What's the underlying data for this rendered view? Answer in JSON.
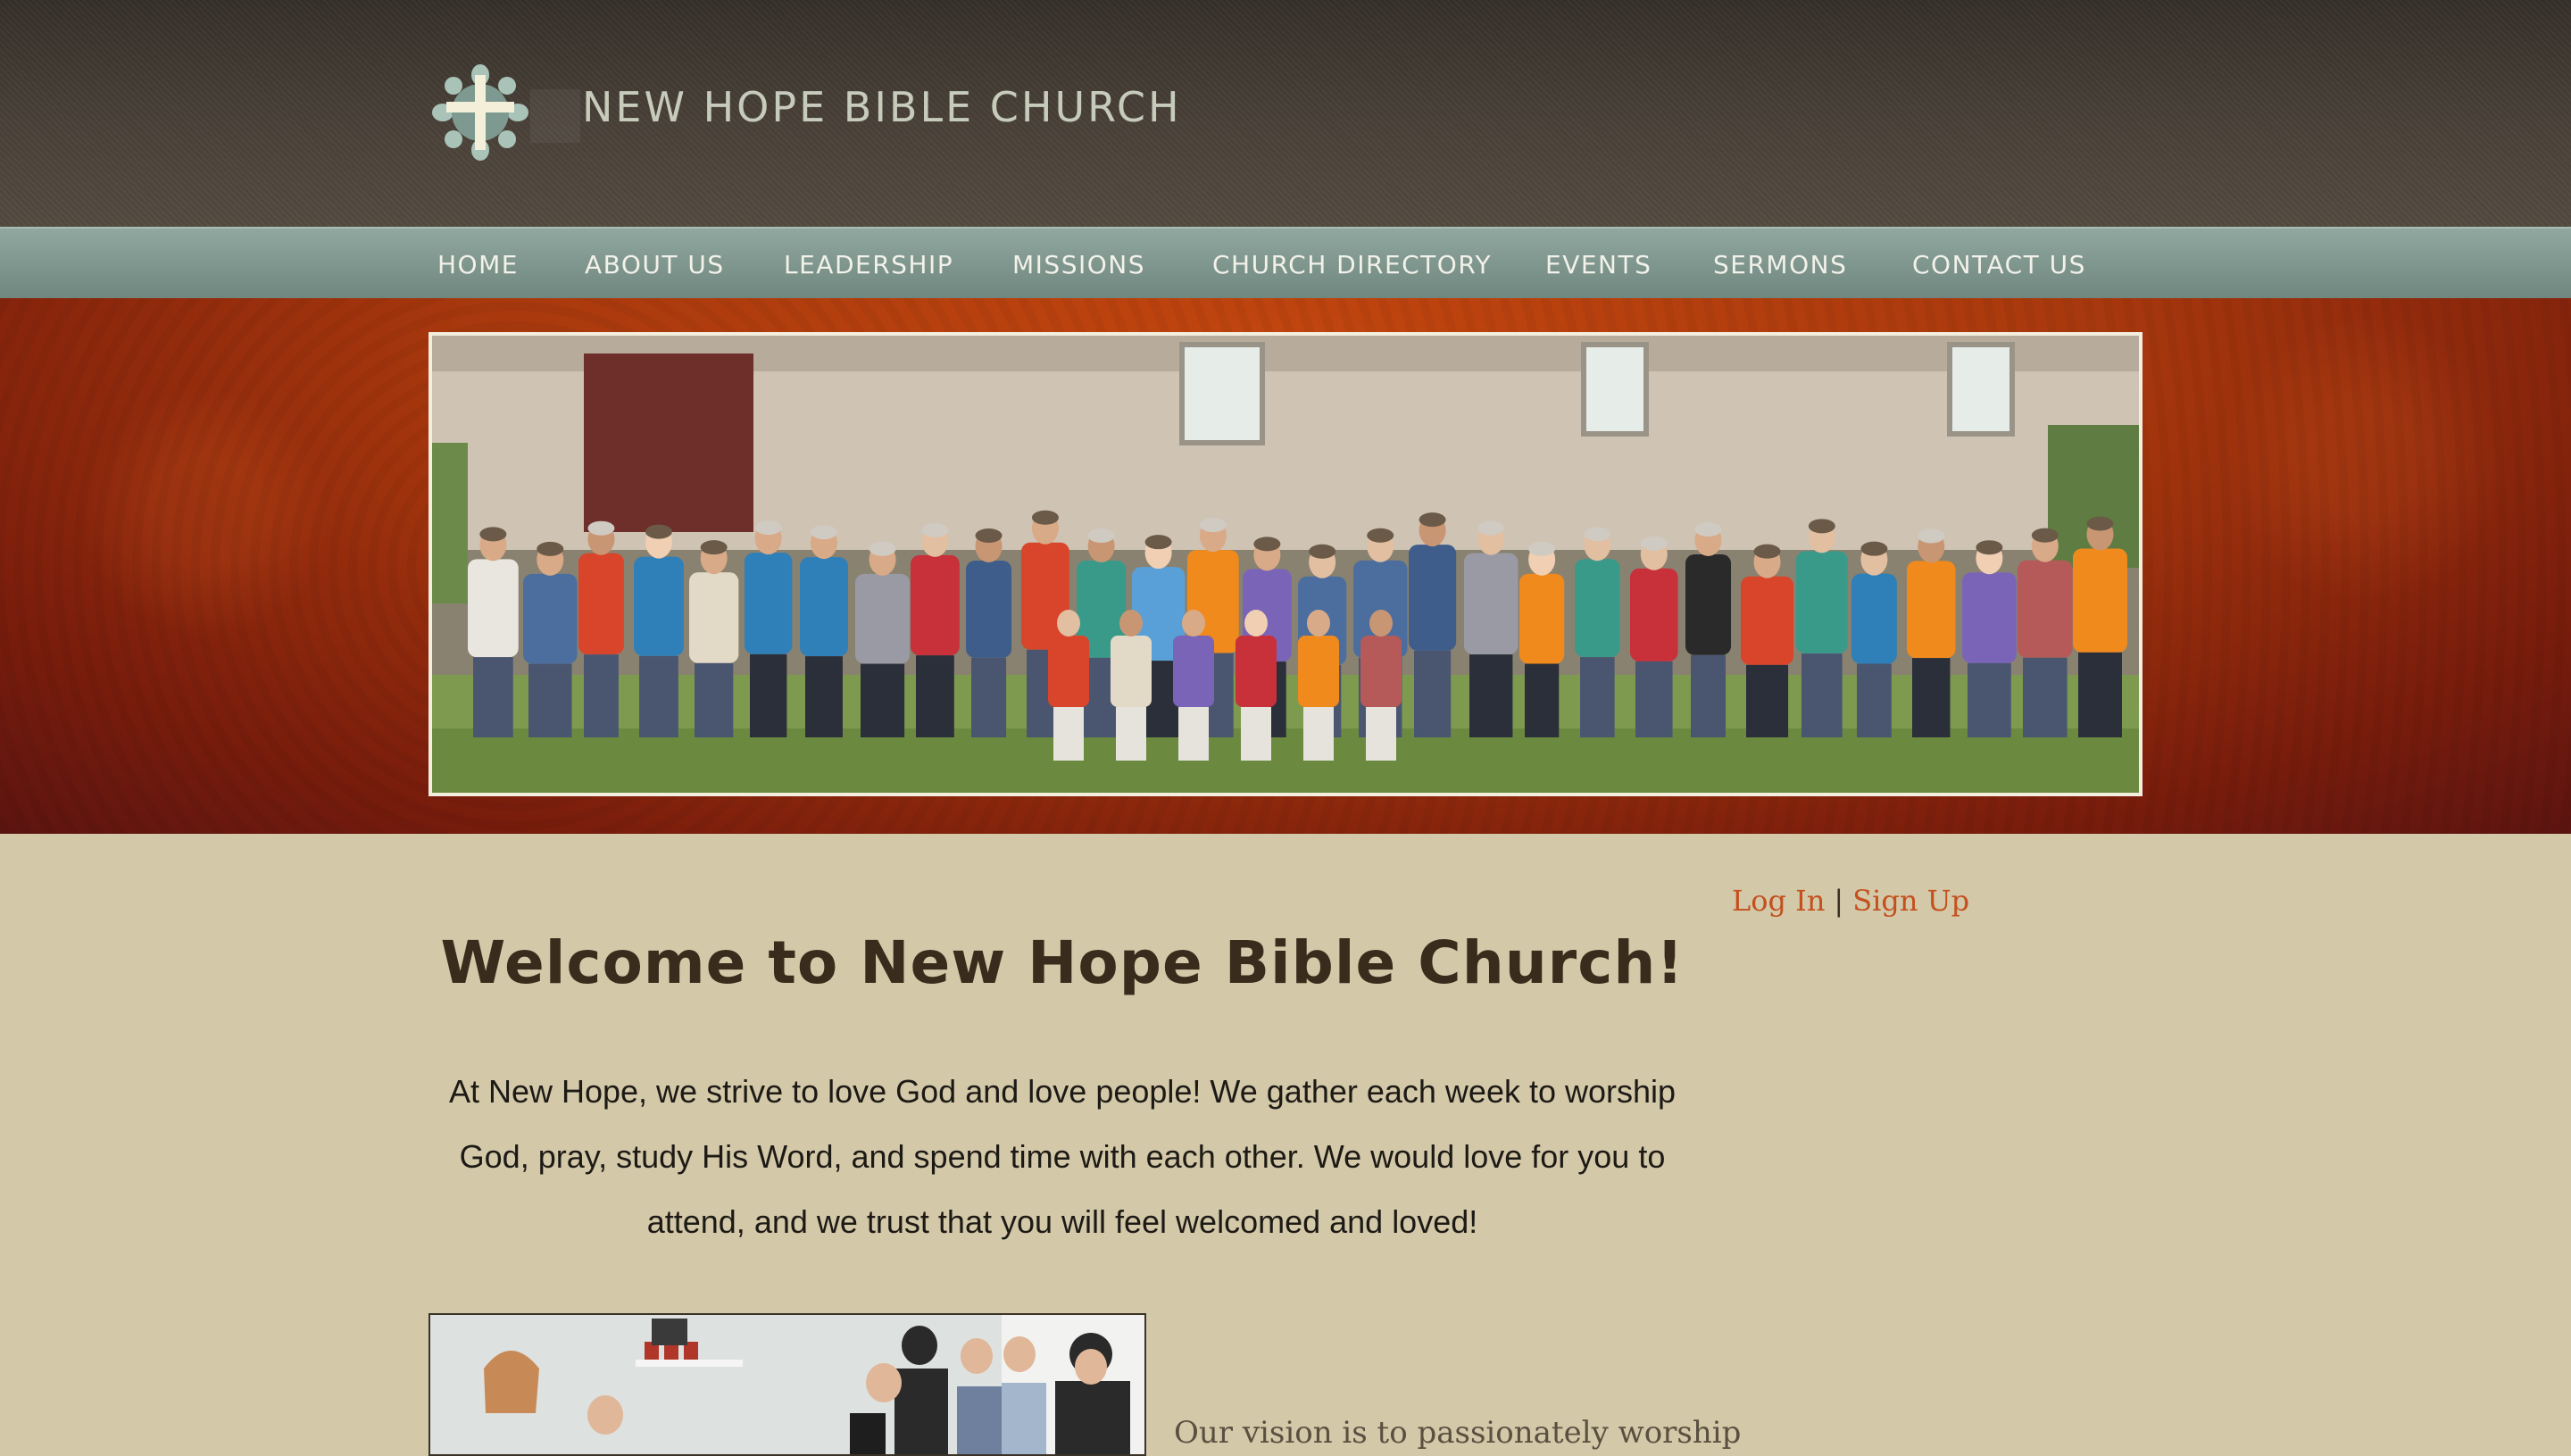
{
  "header": {
    "site_title": "NEW HOPE BIBLE CHURCH",
    "logo_icon": "cross-flower-icon"
  },
  "nav": {
    "items": [
      {
        "label": "HOME"
      },
      {
        "label": "ABOUT US"
      },
      {
        "label": "LEADERSHIP"
      },
      {
        "label": "MISSIONS"
      },
      {
        "label": "CHURCH DIRECTORY"
      },
      {
        "label": "EVENTS"
      },
      {
        "label": "SERMONS"
      },
      {
        "label": "CONTACT US"
      }
    ]
  },
  "auth": {
    "login_label": "Log In",
    "separator": "|",
    "signup_label": "Sign Up"
  },
  "main": {
    "welcome_title": "Welcome to New Hope Bible Church!",
    "intro_text": "At New Hope, we strive to love God and love people! We gather each week to worship God, pray, study His Word, and spend time with each other. We would love for you to attend, and we trust that you will feel welcomed and loved!",
    "vision_text": "Our vision is to passionately worship"
  },
  "colors": {
    "header_bg": "#453d35",
    "nav_bg": "#8aa29a",
    "banner_bg": "#a8380d",
    "page_bg": "#d3c8a8",
    "link": "#c4501e",
    "heading": "#3a2c1c"
  }
}
